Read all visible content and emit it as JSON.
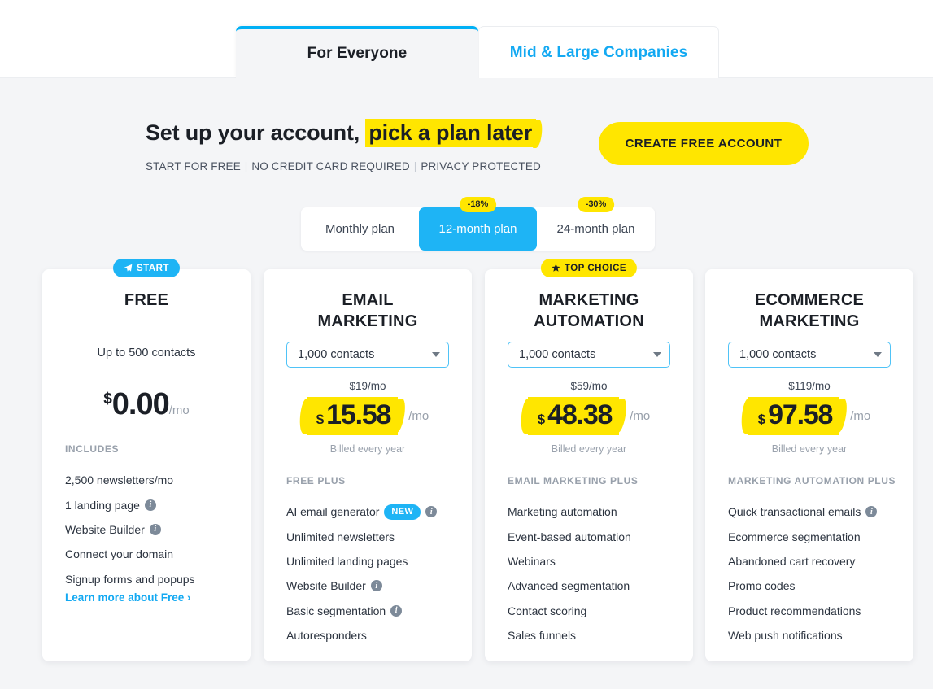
{
  "tabs": [
    {
      "label": "For Everyone",
      "active": true
    },
    {
      "label": "Mid & Large Companies",
      "active": false
    }
  ],
  "hero": {
    "title_plain": "Set up your account,",
    "title_highlight": "pick a plan later",
    "sub_1": "START FOR FREE",
    "sub_2": "NO CREDIT CARD REQUIRED",
    "sub_3": "PRIVACY PROTECTED",
    "cta_label": "CREATE FREE ACCOUNT"
  },
  "billing_toggle": {
    "options": [
      {
        "label": "Monthly plan",
        "discount": "",
        "selected": false
      },
      {
        "label": "12-month plan",
        "discount": "-18%",
        "selected": true
      },
      {
        "label": "24-month plan",
        "discount": "-30%",
        "selected": false
      }
    ]
  },
  "colors": {
    "accent_blue": "#1eb4f5",
    "link_blue": "#13a9f2",
    "highlight_yellow": "#ffe600",
    "page_bg": "#f4f5f7",
    "text_dark": "#1b1f26",
    "text_muted": "#98a0ab"
  },
  "plans": [
    {
      "id": "free",
      "ribbon": {
        "label": "START",
        "icon": "paper-plane-icon",
        "style": "blue"
      },
      "title": "FREE",
      "contacts_note": "Up to 500 contacts",
      "price": {
        "currency": "$",
        "amount": "0.00",
        "period": "/mo"
      },
      "features_heading": "INCLUDES",
      "features": [
        {
          "label": "2,500 newsletters/mo",
          "info": false,
          "badge": ""
        },
        {
          "label": "1 landing page",
          "info": true,
          "badge": ""
        },
        {
          "label": "Website Builder",
          "info": true,
          "badge": ""
        },
        {
          "label": "Connect your domain",
          "info": false,
          "badge": ""
        },
        {
          "label": "Signup forms and popups",
          "info": false,
          "badge": ""
        }
      ],
      "learn_more": "Learn more about Free ›"
    },
    {
      "id": "email-marketing",
      "ribbon": null,
      "title_line1": "EMAIL",
      "title_line2": "MARKETING",
      "contacts_select": "1,000 contacts",
      "old_price": "$19/mo",
      "price": {
        "currency": "$",
        "amount": "15.58",
        "period": "/mo"
      },
      "billed": "Billed every year",
      "features_heading": "FREE PLUS",
      "features": [
        {
          "label": "AI email generator",
          "info": true,
          "badge": "NEW"
        },
        {
          "label": "Unlimited newsletters",
          "info": false,
          "badge": ""
        },
        {
          "label": "Unlimited landing pages",
          "info": false,
          "badge": ""
        },
        {
          "label": "Website Builder",
          "info": true,
          "badge": ""
        },
        {
          "label": "Basic segmentation",
          "info": true,
          "badge": ""
        },
        {
          "label": "Autoresponders",
          "info": false,
          "badge": ""
        }
      ]
    },
    {
      "id": "marketing-automation",
      "ribbon": {
        "label": "TOP CHOICE",
        "icon": "star-icon",
        "style": "yellow"
      },
      "title_line1": "MARKETING",
      "title_line2": "AUTOMATION",
      "contacts_select": "1,000 contacts",
      "old_price": "$59/mo",
      "price": {
        "currency": "$",
        "amount": "48.38",
        "period": "/mo"
      },
      "billed": "Billed every year",
      "features_heading": "EMAIL MARKETING PLUS",
      "features": [
        {
          "label": "Marketing automation",
          "info": false,
          "badge": ""
        },
        {
          "label": "Event-based automation",
          "info": false,
          "badge": ""
        },
        {
          "label": "Webinars",
          "info": false,
          "badge": ""
        },
        {
          "label": "Advanced segmentation",
          "info": false,
          "badge": ""
        },
        {
          "label": "Contact scoring",
          "info": false,
          "badge": ""
        },
        {
          "label": "Sales funnels",
          "info": false,
          "badge": ""
        }
      ]
    },
    {
      "id": "ecommerce-marketing",
      "ribbon": null,
      "title_line1": "ECOMMERCE",
      "title_line2": "MARKETING",
      "contacts_select": "1,000 contacts",
      "old_price": "$119/mo",
      "price": {
        "currency": "$",
        "amount": "97.58",
        "period": "/mo"
      },
      "billed": "Billed every year",
      "features_heading": "MARKETING AUTOMATION PLUS",
      "features": [
        {
          "label": "Quick transactional emails",
          "info": true,
          "badge": ""
        },
        {
          "label": "Ecommerce segmentation",
          "info": false,
          "badge": ""
        },
        {
          "label": "Abandoned cart recovery",
          "info": false,
          "badge": ""
        },
        {
          "label": "Promo codes",
          "info": false,
          "badge": ""
        },
        {
          "label": "Product recommendations",
          "info": false,
          "badge": ""
        },
        {
          "label": "Web push notifications",
          "info": false,
          "badge": ""
        }
      ]
    }
  ]
}
